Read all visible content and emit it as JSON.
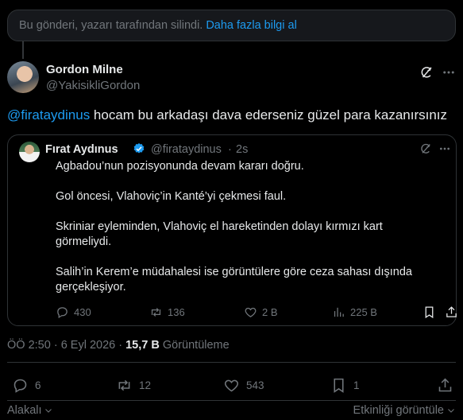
{
  "banner": {
    "text": "Bu gönderi, yazarı tarafından silindi.",
    "link": "Daha fazla bilgi al"
  },
  "author": {
    "name": "Gordon Milne",
    "handle": "@YakisikliGordon"
  },
  "tweet": {
    "mention": "@firataydinus",
    "text": " hocam bu arkadaşı dava ederseniz güzel para kazanırsınız"
  },
  "quote": {
    "name": "Fırat Aydınus",
    "handle": "@firataydinus",
    "dot": "·",
    "time": "2s",
    "paragraphs": [
      "Agbadou’nun pozisyonunda  devam kararı doğru.",
      "Gol öncesi, Vlahoviç’in Kanté’yi çekmesi faul.",
      "Skriniar eyleminden, Vlahoviç el hareketinden dolayı  kırmızı kart görmeliydi.",
      "Salih’in Kerem’e müdahalesi ise görüntülere göre ceza sahası dışında gerçekleşiyor."
    ],
    "stats": {
      "replies": "430",
      "reposts": "136",
      "likes": "2 B",
      "views": "225 B"
    }
  },
  "meta": {
    "time_date": "ÖÖ 2:50 · 6 Eyl 2026 · ",
    "views_count": "15,7 B",
    "views_label": " Görüntüleme"
  },
  "actions": {
    "replies": "6",
    "reposts": "12",
    "likes": "543",
    "bookmarks": "1"
  },
  "footer": {
    "left": "Alakalı",
    "right": "Etkinliği görüntüle"
  },
  "colors": {
    "accent": "#1d9bf0",
    "muted": "#71767b",
    "text": "#e7e9ea",
    "border": "#2f3336",
    "background": "#000000"
  }
}
